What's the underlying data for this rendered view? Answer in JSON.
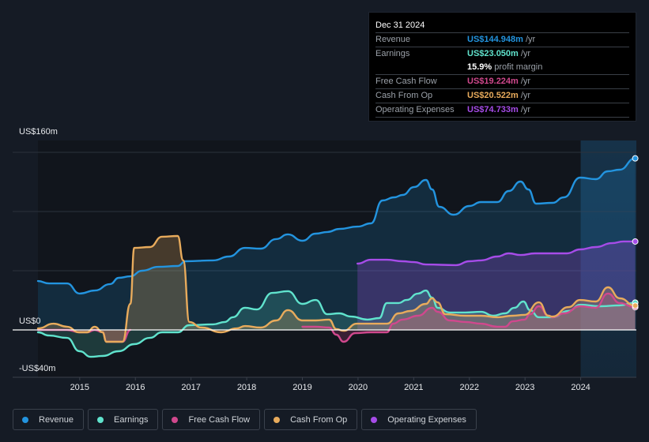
{
  "tooltip": {
    "date": "Dec 31 2024",
    "rows": [
      {
        "label": "Revenue",
        "value": "US$144.948m",
        "unit": "/yr",
        "color": "#2394df"
      },
      {
        "label": "Earnings",
        "value": "US$23.050m",
        "unit": "/yr",
        "color": "#60e3cd"
      },
      {
        "label": "",
        "value": "15.9%",
        "unit": "profit margin",
        "color": "#ffffff"
      },
      {
        "label": "Free Cash Flow",
        "value": "US$19.224m",
        "unit": "/yr",
        "color": "#d0488d"
      },
      {
        "label": "Cash From Op",
        "value": "US$20.522m",
        "unit": "/yr",
        "color": "#e8ab5c"
      },
      {
        "label": "Operating Expenses",
        "value": "US$74.733m",
        "unit": "/yr",
        "color": "#a64ce8"
      }
    ]
  },
  "legend": [
    {
      "label": "Revenue",
      "color": "#2394df"
    },
    {
      "label": "Earnings",
      "color": "#60e3cd"
    },
    {
      "label": "Free Cash Flow",
      "color": "#d0488d"
    },
    {
      "label": "Cash From Op",
      "color": "#e8ab5c"
    },
    {
      "label": "Operating Expenses",
      "color": "#a64ce8"
    }
  ],
  "chart_data": {
    "type": "area",
    "title": "",
    "xlabel": "",
    "ylabel": "",
    "xlim": [
      2014.25,
      2025.0
    ],
    "ylim": [
      -40,
      160
    ],
    "y_tick_labels": [
      {
        "value": 160,
        "label": "US$160m"
      },
      {
        "value": 0,
        "label": "US$0"
      },
      {
        "value": -40,
        "label": "-US$40m"
      }
    ],
    "gridlines": [
      150,
      100,
      50
    ],
    "x_ticks": [
      2015,
      2016,
      2017,
      2018,
      2019,
      2020,
      2021,
      2022,
      2023,
      2024
    ],
    "highlight_range": [
      2024.0,
      2025.0
    ],
    "series": [
      {
        "name": "Revenue",
        "color": "#2394df",
        "points": [
          [
            2014.25,
            41.3
          ],
          [
            2014.45,
            39.3
          ],
          [
            2014.77,
            39.3
          ],
          [
            2015.0,
            30.7
          ],
          [
            2015.27,
            33.3
          ],
          [
            2015.55,
            38.7
          ],
          [
            2015.7,
            44.0
          ],
          [
            2015.91,
            45.3
          ],
          [
            2016.12,
            50.0
          ],
          [
            2016.41,
            53.3
          ],
          [
            2016.76,
            54.0
          ],
          [
            2016.9,
            58.0
          ],
          [
            2017.4,
            58.7
          ],
          [
            2017.68,
            62.0
          ],
          [
            2017.97,
            69.3
          ],
          [
            2018.25,
            68.7
          ],
          [
            2018.53,
            76.7
          ],
          [
            2018.74,
            80.7
          ],
          [
            2019.0,
            75.3
          ],
          [
            2019.24,
            81.3
          ],
          [
            2019.45,
            82.7
          ],
          [
            2019.66,
            85.3
          ],
          [
            2019.99,
            87.3
          ],
          [
            2020.23,
            90.0
          ],
          [
            2020.44,
            109.3
          ],
          [
            2020.65,
            112.0
          ],
          [
            2020.8,
            114.0
          ],
          [
            2021.01,
            120.7
          ],
          [
            2021.22,
            126.7
          ],
          [
            2021.33,
            118.7
          ],
          [
            2021.46,
            104.0
          ],
          [
            2021.72,
            97.3
          ],
          [
            2022.0,
            104.7
          ],
          [
            2022.21,
            108.0
          ],
          [
            2022.5,
            108.0
          ],
          [
            2022.71,
            117.3
          ],
          [
            2022.92,
            125.3
          ],
          [
            2023.06,
            118.7
          ],
          [
            2023.2,
            106.7
          ],
          [
            2023.49,
            107.3
          ],
          [
            2023.7,
            112.0
          ],
          [
            2023.99,
            128.7
          ],
          [
            2024.27,
            127.3
          ],
          [
            2024.49,
            134.0
          ],
          [
            2024.7,
            135.3
          ],
          [
            2024.98,
            144.9
          ]
        ]
      },
      {
        "name": "Earnings",
        "color": "#60e3cd",
        "points": [
          [
            2014.25,
            -2.0
          ],
          [
            2014.45,
            -4.7
          ],
          [
            2014.77,
            -6.7
          ],
          [
            2015.0,
            -18.0
          ],
          [
            2015.2,
            -22.7
          ],
          [
            2015.41,
            -22.0
          ],
          [
            2015.7,
            -18.0
          ],
          [
            2015.98,
            -12.0
          ],
          [
            2016.26,
            -6.7
          ],
          [
            2016.48,
            -2.0
          ],
          [
            2016.76,
            -2.0
          ],
          [
            2016.97,
            4.0
          ],
          [
            2017.4,
            4.7
          ],
          [
            2017.61,
            6.7
          ],
          [
            2017.75,
            10.7
          ],
          [
            2017.97,
            18.7
          ],
          [
            2018.18,
            17.3
          ],
          [
            2018.46,
            31.3
          ],
          [
            2018.74,
            32.7
          ],
          [
            2019.0,
            22.0
          ],
          [
            2019.24,
            25.3
          ],
          [
            2019.45,
            13.3
          ],
          [
            2019.66,
            14.0
          ],
          [
            2019.88,
            11.3
          ],
          [
            2020.17,
            8.7
          ],
          [
            2020.38,
            10.0
          ],
          [
            2020.52,
            22.7
          ],
          [
            2020.73,
            22.7
          ],
          [
            2020.87,
            25.3
          ],
          [
            2021.08,
            30.7
          ],
          [
            2021.22,
            33.3
          ],
          [
            2021.33,
            27.3
          ],
          [
            2021.43,
            18.7
          ],
          [
            2021.65,
            14.7
          ],
          [
            2021.93,
            14.7
          ],
          [
            2022.21,
            15.3
          ],
          [
            2022.43,
            12.0
          ],
          [
            2022.64,
            14.0
          ],
          [
            2022.81,
            18.7
          ],
          [
            2022.97,
            24.0
          ],
          [
            2023.09,
            16.7
          ],
          [
            2023.25,
            10.7
          ],
          [
            2023.49,
            10.7
          ],
          [
            2023.78,
            16.0
          ],
          [
            2023.99,
            21.3
          ],
          [
            2024.35,
            20.0
          ],
          [
            2024.7,
            20.7
          ],
          [
            2024.98,
            23.1
          ]
        ]
      },
      {
        "name": "Free Cash Flow",
        "color": "#d0488d",
        "points": [
          [
            2014.25,
            0
          ],
          [
            2014.45,
            0
          ],
          [
            2014.77,
            0
          ],
          [
            2015.0,
            -2.0
          ],
          [
            2015.14,
            -2.0
          ],
          [
            2015.27,
            0
          ],
          [
            2015.41,
            -2.0
          ],
          [
            2015.48,
            -10.0
          ],
          [
            2015.77,
            -10.0
          ],
          [
            2015.91,
            0
          ],
          [
            2019.0,
            2.7
          ],
          [
            2019.24,
            2.7
          ],
          [
            2019.48,
            2.0
          ],
          [
            2019.61,
            -4.0
          ],
          [
            2019.74,
            -10.0
          ],
          [
            2019.95,
            -2.7
          ],
          [
            2020.23,
            -2.0
          ],
          [
            2020.52,
            -2.0
          ],
          [
            2020.63,
            5.3
          ],
          [
            2020.8,
            8.7
          ],
          [
            2021.08,
            12.0
          ],
          [
            2021.33,
            18.7
          ],
          [
            2021.43,
            15.3
          ],
          [
            2021.65,
            8.0
          ],
          [
            2021.93,
            6.7
          ],
          [
            2022.21,
            5.3
          ],
          [
            2022.5,
            2.7
          ],
          [
            2022.64,
            2.7
          ],
          [
            2022.78,
            7.3
          ],
          [
            2022.99,
            8.7
          ],
          [
            2023.09,
            13.3
          ],
          [
            2023.25,
            20.0
          ],
          [
            2023.42,
            12.0
          ],
          [
            2023.49,
            10.7
          ],
          [
            2023.7,
            14.0
          ],
          [
            2023.99,
            20.0
          ],
          [
            2024.27,
            18.7
          ],
          [
            2024.49,
            30.7
          ],
          [
            2024.7,
            22.7
          ],
          [
            2024.98,
            19.2
          ]
        ]
      },
      {
        "name": "Cash From Op",
        "color": "#e8ab5c",
        "points": [
          [
            2014.25,
            1.3
          ],
          [
            2014.53,
            5.3
          ],
          [
            2014.77,
            2.7
          ],
          [
            2014.99,
            -2.0
          ],
          [
            2015.13,
            -2.0
          ],
          [
            2015.27,
            2.7
          ],
          [
            2015.41,
            -2.0
          ],
          [
            2015.48,
            -10.0
          ],
          [
            2015.77,
            -10.0
          ],
          [
            2015.91,
            22.0
          ],
          [
            2015.98,
            69.3
          ],
          [
            2016.26,
            70.0
          ],
          [
            2016.48,
            78.7
          ],
          [
            2016.76,
            79.3
          ],
          [
            2016.86,
            58.7
          ],
          [
            2016.97,
            6.7
          ],
          [
            2017.19,
            2.0
          ],
          [
            2017.54,
            -2.0
          ],
          [
            2017.82,
            1.3
          ],
          [
            2017.97,
            3.3
          ],
          [
            2018.25,
            2.0
          ],
          [
            2018.53,
            8.0
          ],
          [
            2018.74,
            16.7
          ],
          [
            2019.0,
            8.0
          ],
          [
            2019.24,
            8.0
          ],
          [
            2019.48,
            8.7
          ],
          [
            2019.61,
            0.7
          ],
          [
            2019.74,
            -0.7
          ],
          [
            2019.98,
            5.3
          ],
          [
            2020.23,
            5.3
          ],
          [
            2020.52,
            5.3
          ],
          [
            2020.73,
            14.0
          ],
          [
            2020.94,
            16.0
          ],
          [
            2021.22,
            22.0
          ],
          [
            2021.33,
            26.7
          ],
          [
            2021.43,
            23.3
          ],
          [
            2021.57,
            13.3
          ],
          [
            2021.93,
            12.0
          ],
          [
            2022.21,
            12.0
          ],
          [
            2022.5,
            10.7
          ],
          [
            2022.78,
            12.0
          ],
          [
            2022.99,
            12.7
          ],
          [
            2023.25,
            23.3
          ],
          [
            2023.42,
            12.0
          ],
          [
            2023.49,
            11.3
          ],
          [
            2023.78,
            19.3
          ],
          [
            2023.99,
            25.3
          ],
          [
            2024.27,
            24.0
          ],
          [
            2024.49,
            36.0
          ],
          [
            2024.7,
            26.7
          ],
          [
            2024.98,
            20.5
          ]
        ]
      },
      {
        "name": "Operating Expenses",
        "color": "#a64ce8",
        "points": [
          [
            2019.99,
            56.0
          ],
          [
            2020.23,
            59.3
          ],
          [
            2020.52,
            59.3
          ],
          [
            2020.8,
            58.0
          ],
          [
            2021.01,
            57.3
          ],
          [
            2021.22,
            55.3
          ],
          [
            2021.76,
            54.7
          ],
          [
            2022.0,
            58.0
          ],
          [
            2022.21,
            58.7
          ],
          [
            2022.5,
            62.0
          ],
          [
            2022.71,
            64.7
          ],
          [
            2022.92,
            63.3
          ],
          [
            2023.18,
            64.7
          ],
          [
            2023.49,
            64.7
          ],
          [
            2023.75,
            64.7
          ],
          [
            2023.99,
            68.0
          ],
          [
            2024.27,
            70.0
          ],
          [
            2024.56,
            73.3
          ],
          [
            2024.77,
            74.7
          ],
          [
            2024.98,
            74.7
          ]
        ]
      }
    ]
  }
}
